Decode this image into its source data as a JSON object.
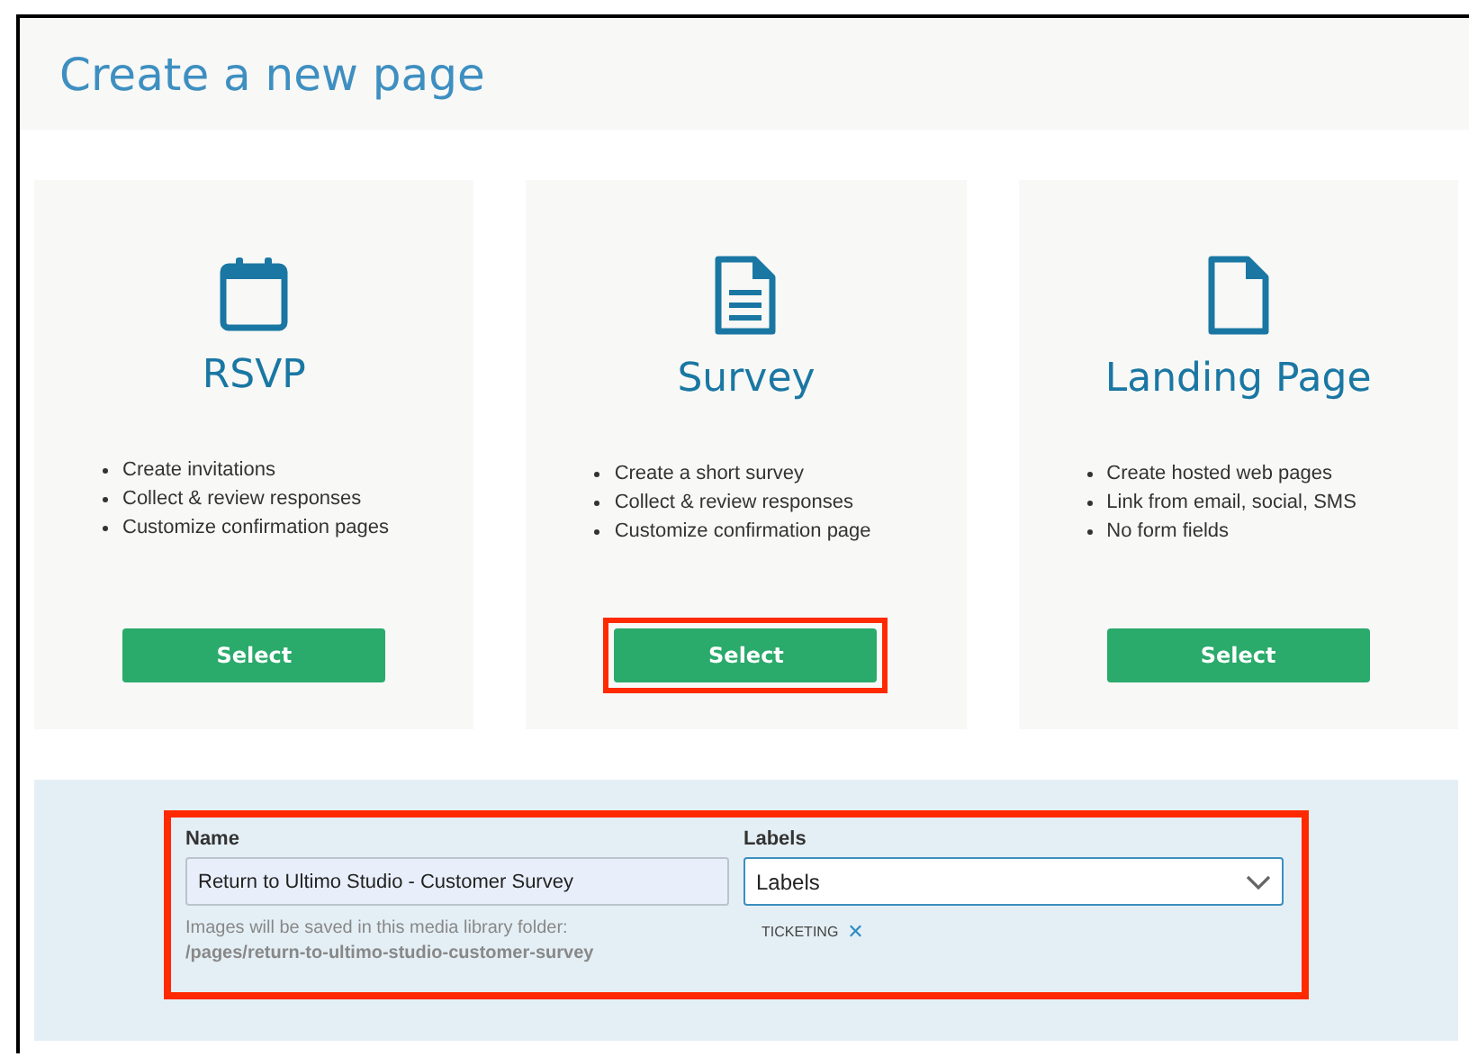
{
  "header": {
    "title": "Create a new page"
  },
  "cards": [
    {
      "kind": "calendar",
      "title": "RSVP",
      "features": [
        "Create invitations",
        "Collect & review responses",
        "Customize confirmation pages"
      ],
      "button": "Select",
      "highlighted": false
    },
    {
      "kind": "document",
      "title": "Survey",
      "features": [
        "Create a short survey",
        "Collect & review responses",
        "Customize confirmation page"
      ],
      "button": "Select",
      "highlighted": true
    },
    {
      "kind": "blank",
      "title": "Landing Page",
      "features": [
        "Create hosted web pages",
        "Link from email, social, SMS",
        "No form fields"
      ],
      "button": "Select",
      "highlighted": false
    }
  ],
  "form": {
    "highlighted": true,
    "name": {
      "label": "Name",
      "value": "Return to Ultimo Studio - Customer Survey",
      "hint": "Images will be saved in this media library folder:",
      "path": "/pages/return-to-ultimo-studio-customer-survey"
    },
    "labels": {
      "label": "Labels",
      "value": "Labels",
      "tags": [
        {
          "text": "TICKETING",
          "remove": "✕"
        }
      ]
    }
  }
}
